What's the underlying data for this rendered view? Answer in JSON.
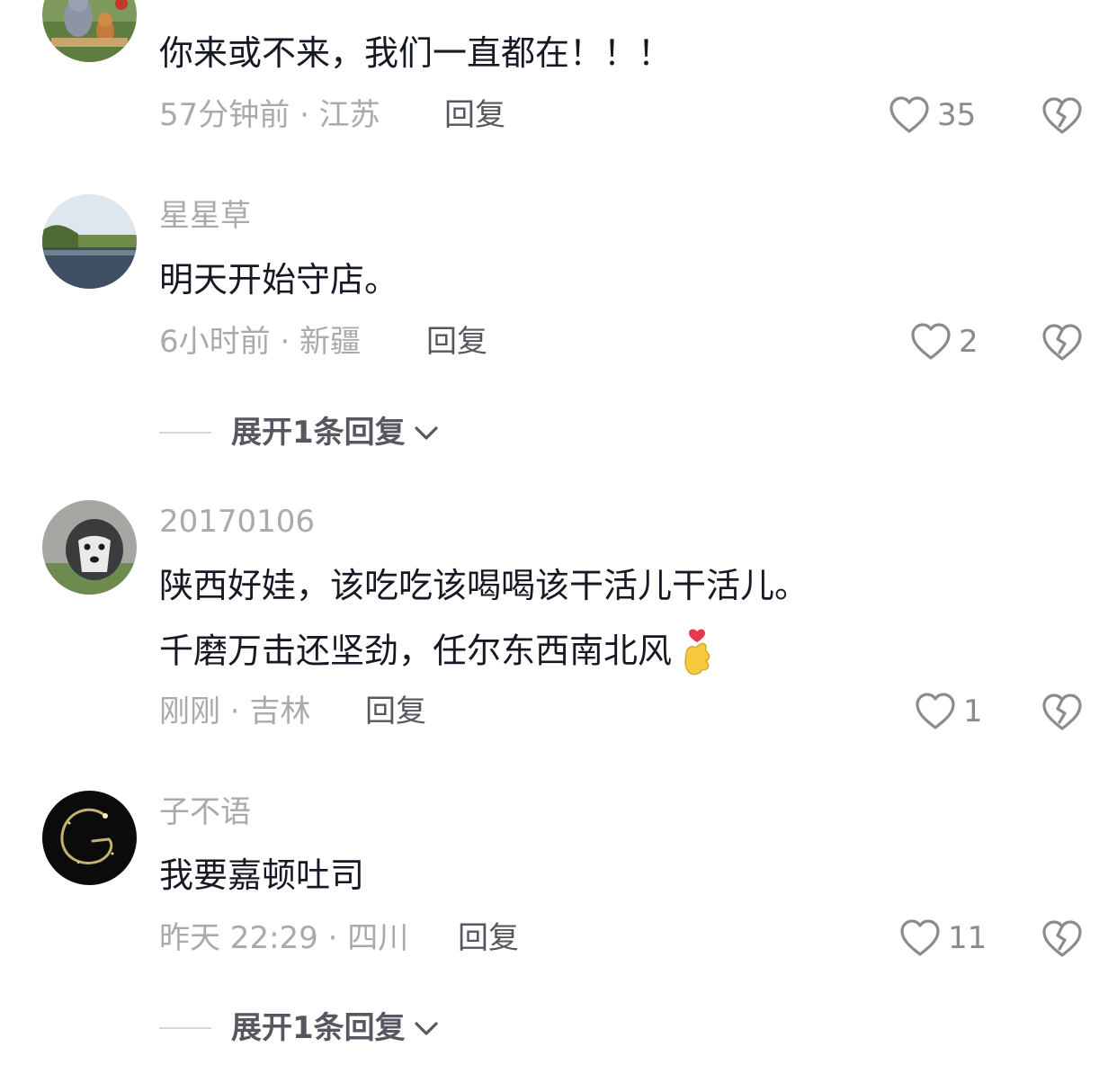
{
  "comments": [
    {
      "username": "",
      "lines": [
        "你来或不来，我们一直都在！！！"
      ],
      "time_location": "57分钟前 · 江苏",
      "reply_label": "回复",
      "likes": "35"
    },
    {
      "username": "星星草",
      "lines": [
        "明天开始守店。"
      ],
      "time_location": "6小时前 · 新疆",
      "reply_label": "回复",
      "likes": "2",
      "expand_label": "展开1条回复"
    },
    {
      "username": "20170106",
      "lines": [
        "陕西好娃，该吃吃该喝喝该干活儿干活儿。",
        "千磨万击还坚劲，任尔东西南北风"
      ],
      "time_location": "刚刚 · 吉林",
      "reply_label": "回复",
      "likes": "1"
    },
    {
      "username": "子不语",
      "lines": [
        "我要嘉顿吐司"
      ],
      "time_location": "昨天 22:29 · 四川",
      "reply_label": "回复",
      "likes": "11",
      "expand_label": "展开1条回复"
    }
  ],
  "icons": {
    "like": "heart-outline-icon",
    "dislike": "broken-heart-icon",
    "expand": "chevron-down-icon",
    "emoji": "finger-heart-emoji"
  }
}
